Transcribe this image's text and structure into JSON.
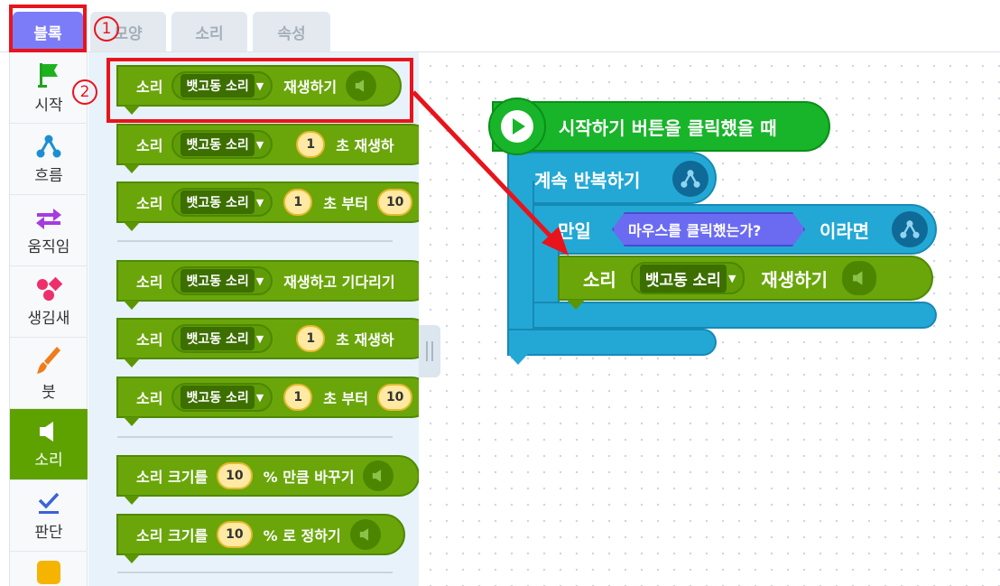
{
  "tabs": [
    {
      "label": "블록",
      "active": true
    },
    {
      "label": "모양",
      "active": false
    },
    {
      "label": "소리",
      "active": false
    },
    {
      "label": "속성",
      "active": false
    }
  ],
  "categories": [
    {
      "label": "시작",
      "icon": "flag-icon"
    },
    {
      "label": "흐름",
      "icon": "flow-icon"
    },
    {
      "label": "움직임",
      "icon": "move-arrows-icon"
    },
    {
      "label": "생김새",
      "icon": "shapes-icon"
    },
    {
      "label": "붓",
      "icon": "brush-icon"
    },
    {
      "label": "소리",
      "icon": "speaker-icon",
      "active": true
    },
    {
      "label": "판단",
      "icon": "check-icon"
    }
  ],
  "palette": {
    "b1": {
      "word": "소리",
      "sound": "뱃고동 소리",
      "tail": "재생하기"
    },
    "b2": {
      "word": "소리",
      "sound": "뱃고동 소리",
      "num": "1",
      "tail": "초 재생하"
    },
    "b3": {
      "word": "소리",
      "sound": "뱃고동 소리",
      "num": "1",
      "tail": "초 부터",
      "num2": "10"
    },
    "b4": {
      "word": "소리",
      "sound": "뱃고동 소리",
      "tail": "재생하고 기다리기"
    },
    "b5": {
      "word": "소리",
      "sound": "뱃고동 소리",
      "num": "1",
      "tail": "초 재생하"
    },
    "b6": {
      "word": "소리",
      "sound": "뱃고동 소리",
      "num": "1",
      "tail": "초 부터",
      "num2": "10"
    },
    "b7": {
      "word": "소리 크기를",
      "num": "10",
      "tail": "% 만큼 바꾸기"
    },
    "b8": {
      "word": "소리 크기를",
      "num": "10",
      "tail": "% 로 정하기"
    }
  },
  "script": {
    "hat": "시작하기 버튼을 클릭했을 때",
    "repeat": "계속 반복하기",
    "if_word": "만일",
    "condition": "마우스를 클릭했는가?",
    "if_tail": "이라면",
    "sound_word": "소리",
    "sound_value": "뱃고동 소리",
    "sound_tail": "재생하기"
  },
  "annotations": {
    "step1": "1",
    "step2": "2",
    "color": "#e8141c"
  },
  "colors": {
    "tab_active": "#7d7cf8",
    "sound_block": "#6aa60a",
    "loop_block": "#23a8d5",
    "hat_block": "#18b42a",
    "condition_block": "#6b6bf2"
  }
}
